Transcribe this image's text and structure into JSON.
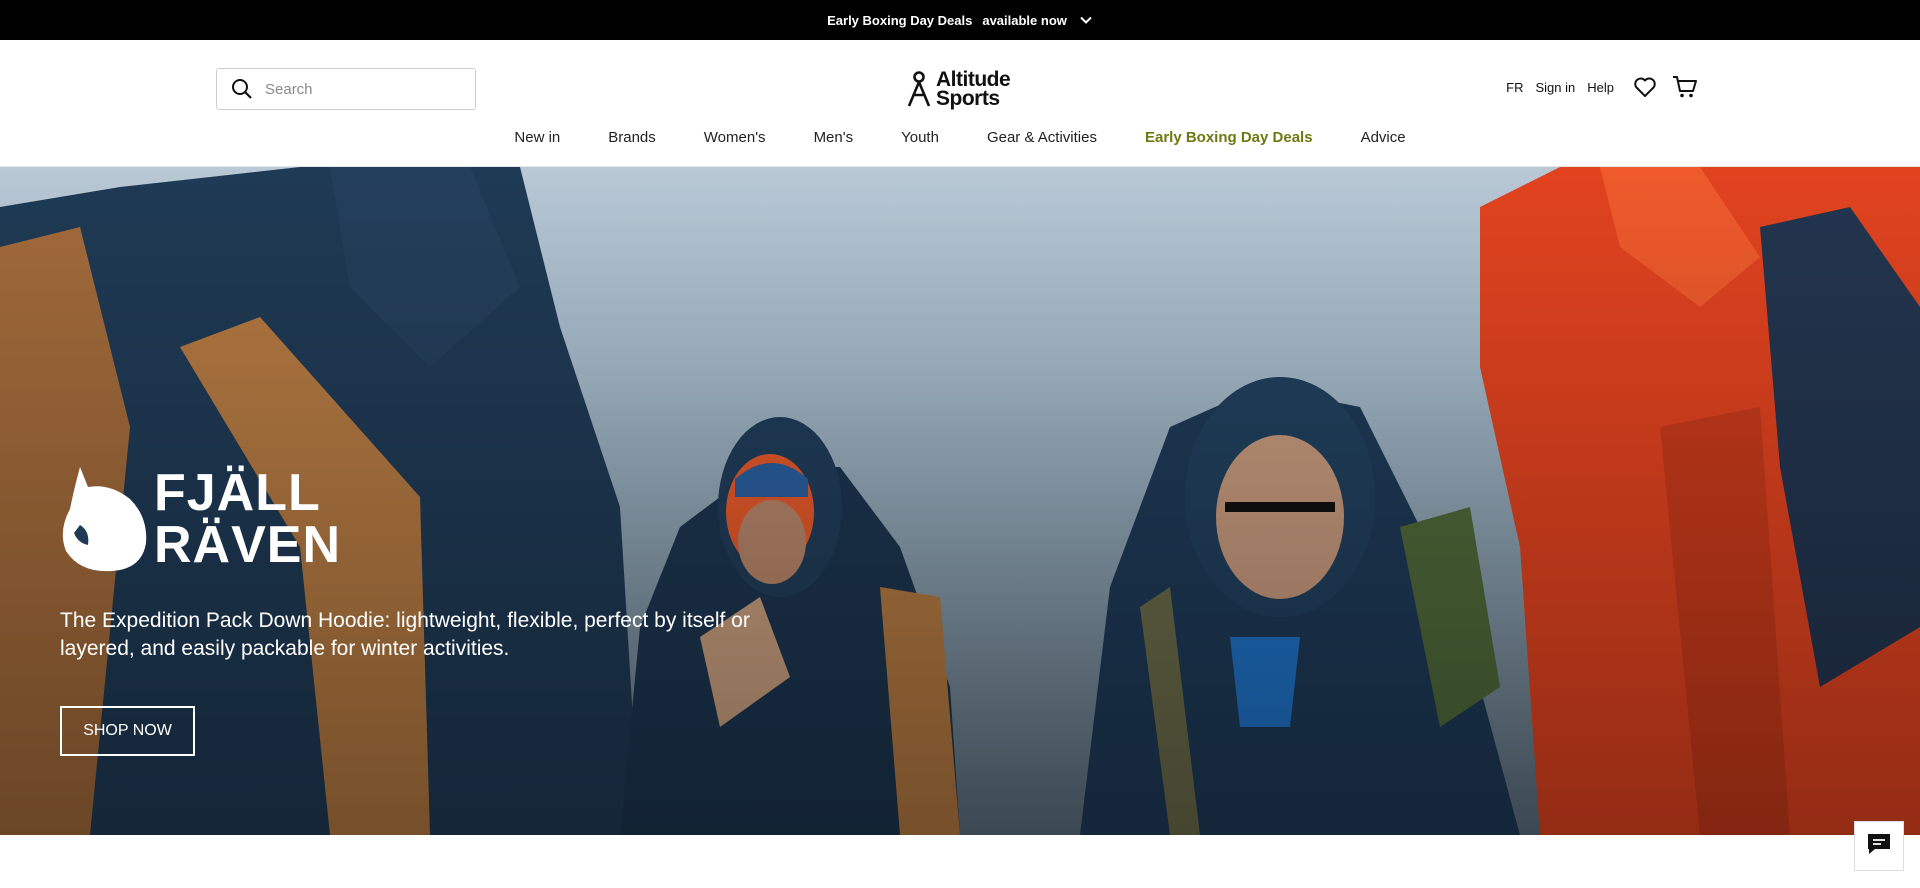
{
  "promo": {
    "text_bold": "Early Boxing Day Deals",
    "text_rest": "available now",
    "toggle_icon": "chevron-down-icon"
  },
  "header": {
    "search": {
      "placeholder": "Search",
      "icon": "search-icon"
    },
    "logo": {
      "line1": "Altitude",
      "line2": "Sports"
    },
    "utility": {
      "language": "FR",
      "sign_in": "Sign in",
      "help": "Help",
      "wishlist_icon": "heart-icon",
      "cart_icon": "cart-icon"
    }
  },
  "nav": {
    "items": [
      {
        "label": "New in"
      },
      {
        "label": "Brands"
      },
      {
        "label": "Women's"
      },
      {
        "label": "Men's"
      },
      {
        "label": "Youth"
      },
      {
        "label": "Gear & Activities"
      },
      {
        "label": "Early Boxing Day Deals"
      },
      {
        "label": "Advice"
      }
    ],
    "highlight_color": "#6c7a12"
  },
  "hero": {
    "brand_logo": {
      "line1": "FJÄLL",
      "line2": "RÄVEN"
    },
    "description": "The Expedition Pack Down Hoodie: lightweight, flexible, perfect by itself or layered, and easily packable for winter activities.",
    "cta_label": "SHOP NOW"
  },
  "chat": {
    "icon": "chat-icon"
  },
  "colors": {
    "promo_bg": "#000000",
    "deal_text": "#6c7a12",
    "jacket_navy": "#1f3a55",
    "jacket_orange": "#e2431f"
  }
}
